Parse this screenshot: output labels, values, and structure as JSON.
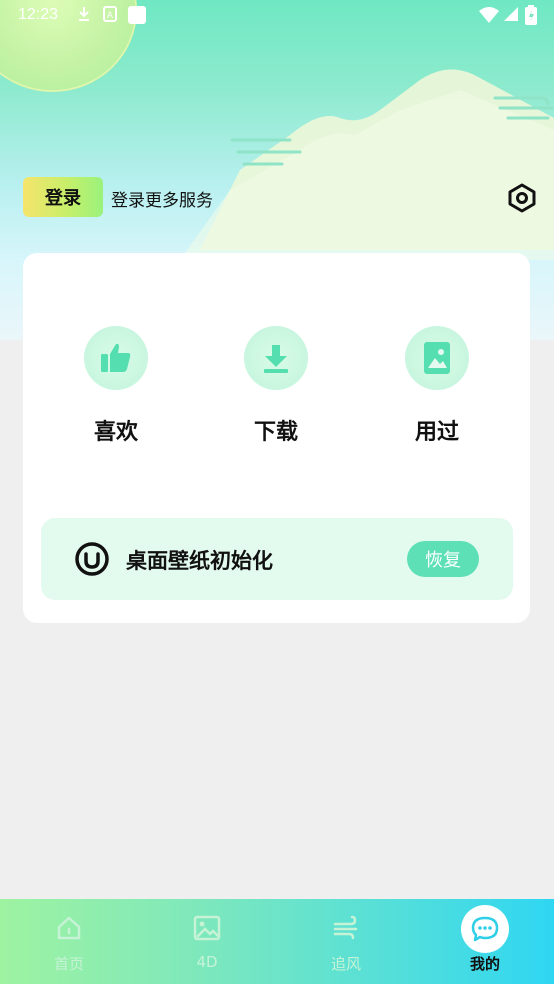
{
  "status_bar": {
    "time": "12:23",
    "icons": [
      "download-icon",
      "sim-icon",
      "notification-icon",
      "wifi-icon",
      "signal-icon",
      "battery-icon"
    ]
  },
  "header": {
    "login_label": "登录",
    "login_subtitle": "登录更多服务",
    "settings_icon": "settings-hexagon-icon"
  },
  "features": [
    {
      "label": "喜欢",
      "icon": "thumbs-up-icon"
    },
    {
      "label": "下载",
      "icon": "download-icon"
    },
    {
      "label": "用过",
      "icon": "image-icon"
    }
  ],
  "reset": {
    "label": "桌面壁纸初始化",
    "button_label": "恢复",
    "icon": "power-icon"
  },
  "bottom_nav": [
    {
      "label": "首页",
      "icon": "home-icon",
      "active": false
    },
    {
      "label": "4D",
      "icon": "picture-icon",
      "active": false
    },
    {
      "label": "追风",
      "icon": "wind-icon",
      "active": false
    },
    {
      "label": "我的",
      "icon": "chat-bubble-icon",
      "active": true
    }
  ],
  "colors": {
    "accent": "#5ee0b6",
    "icon_green": "#55dfb0",
    "card_bg": "#ffffff",
    "page_bg": "#efefef"
  }
}
